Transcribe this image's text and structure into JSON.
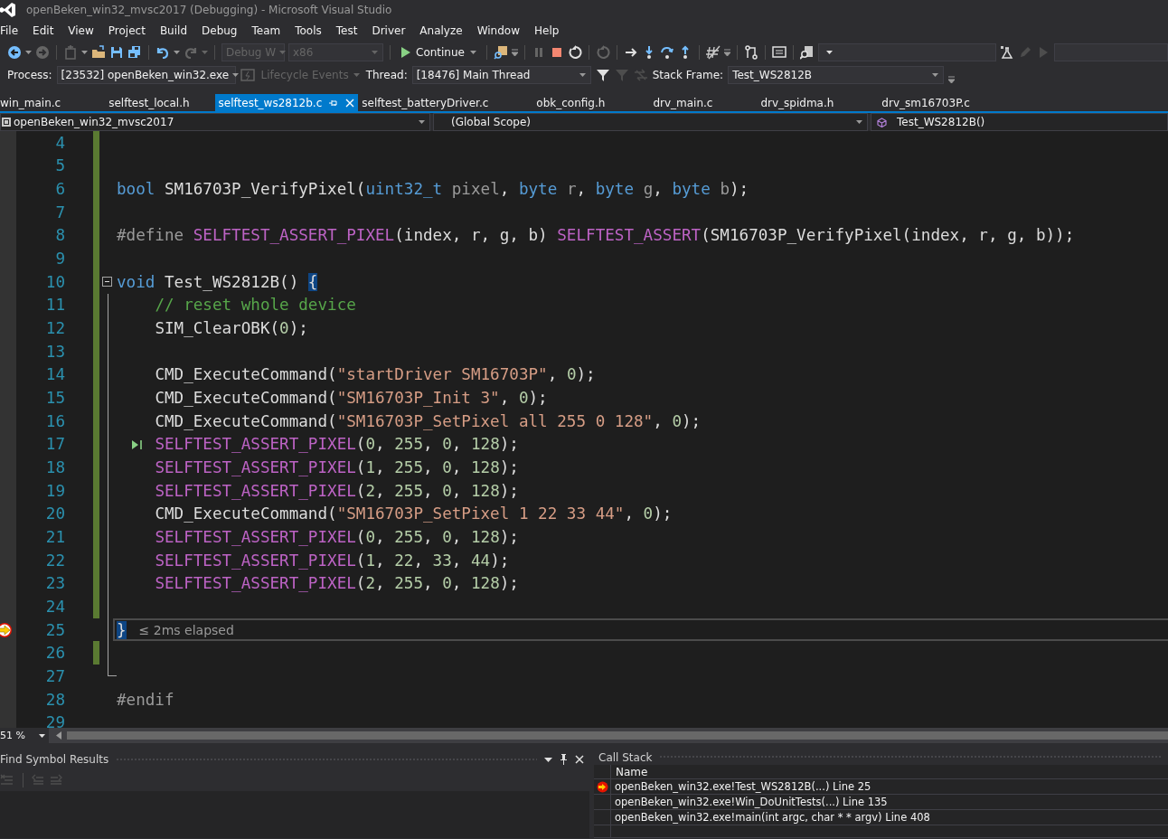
{
  "window": {
    "title": "openBeken_win32_mvsc2017 (Debugging) - Microsoft Visual Studio"
  },
  "menu": [
    "File",
    "Edit",
    "View",
    "Project",
    "Build",
    "Debug",
    "Team",
    "Tools",
    "Test",
    "Driver",
    "Analyze",
    "Window",
    "Help"
  ],
  "toolbar": {
    "configuration": "Debug W",
    "platform": "x86",
    "continue": "Continue"
  },
  "debug_location": {
    "process_label": "Process:",
    "process": "[23532] openBeken_win32.exe",
    "lifecycle": "Lifecycle Events",
    "thread_label": "Thread:",
    "thread": "[18476] Main Thread",
    "stack_frame_label": "Stack Frame:",
    "stack_frame": "Test_WS2812B"
  },
  "tabs": [
    {
      "label": "win_main.c",
      "selected": false
    },
    {
      "label": "selftest_local.h",
      "selected": false
    },
    {
      "label": "selftest_ws2812b.c",
      "selected": true
    },
    {
      "label": "selftest_batteryDriver.c",
      "selected": false
    },
    {
      "label": "obk_config.h",
      "selected": false
    },
    {
      "label": "drv_main.c",
      "selected": false
    },
    {
      "label": "drv_spidma.h",
      "selected": false
    },
    {
      "label": "drv_sm16703P.c",
      "selected": false
    }
  ],
  "navigation": {
    "project": "openBeken_win32_mvsc2017",
    "scope": "(Global Scope)",
    "member": "Test_WS2812B()"
  },
  "editor": {
    "zoom": "51 %",
    "lines": [
      {
        "number": "4",
        "changed": true,
        "foldable": false,
        "in_block": false,
        "current": false,
        "run_to_click": false
      },
      {
        "number": "5",
        "changed": true,
        "foldable": false,
        "in_block": false,
        "current": false,
        "run_to_click": false
      },
      {
        "number": "6",
        "changed": true,
        "foldable": false,
        "in_block": false,
        "current": false,
        "run_to_click": false,
        "tokens": [
          {
            "kind": "keyword",
            "text": "bool"
          },
          {
            "kind": "plain",
            "text": " SM16703P_VerifyPixel("
          },
          {
            "kind": "keyword",
            "text": "uint32_t"
          },
          {
            "kind": "param",
            "text": " pixel"
          },
          {
            "kind": "plain",
            "text": ", "
          },
          {
            "kind": "keyword",
            "text": "byte"
          },
          {
            "kind": "param",
            "text": " r"
          },
          {
            "kind": "plain",
            "text": ", "
          },
          {
            "kind": "keyword",
            "text": "byte"
          },
          {
            "kind": "param",
            "text": " g"
          },
          {
            "kind": "plain",
            "text": ", "
          },
          {
            "kind": "keyword",
            "text": "byte"
          },
          {
            "kind": "param",
            "text": " b"
          },
          {
            "kind": "plain",
            "text": ");"
          }
        ]
      },
      {
        "number": "7",
        "changed": true,
        "foldable": false,
        "in_block": false,
        "current": false,
        "run_to_click": false
      },
      {
        "number": "8",
        "changed": true,
        "foldable": false,
        "in_block": false,
        "current": false,
        "run_to_click": false,
        "tokens": [
          {
            "kind": "preprocessor",
            "text": "#define "
          },
          {
            "kind": "macro",
            "text": "SELFTEST_ASSERT_PIXEL"
          },
          {
            "kind": "plain",
            "text": "(index, r, g, b) "
          },
          {
            "kind": "macro",
            "text": "SELFTEST_ASSERT"
          },
          {
            "kind": "plain",
            "text": "(SM16703P_VerifyPixel(index, r, g, b));"
          }
        ]
      },
      {
        "number": "9",
        "changed": true,
        "foldable": false,
        "in_block": false,
        "current": false,
        "run_to_click": false
      },
      {
        "number": "10",
        "changed": true,
        "foldable": true,
        "in_block": false,
        "current": false,
        "run_to_click": false,
        "tokens": [
          {
            "kind": "keyword",
            "text": "void"
          },
          {
            "kind": "plain",
            "text": " Test_WS2812B() "
          },
          {
            "kind": "match",
            "text": "{"
          }
        ]
      },
      {
        "number": "11",
        "changed": true,
        "foldable": false,
        "in_block": true,
        "current": false,
        "run_to_click": false,
        "tokens": [
          {
            "kind": "comment",
            "text": "    // reset whole device"
          }
        ]
      },
      {
        "number": "12",
        "changed": true,
        "foldable": false,
        "in_block": true,
        "current": false,
        "run_to_click": false,
        "tokens": [
          {
            "kind": "plain",
            "text": "    SIM_ClearOBK("
          },
          {
            "kind": "number",
            "text": "0"
          },
          {
            "kind": "plain",
            "text": ");"
          }
        ]
      },
      {
        "number": "13",
        "changed": true,
        "foldable": false,
        "in_block": true,
        "current": false,
        "run_to_click": false
      },
      {
        "number": "14",
        "changed": true,
        "foldable": false,
        "in_block": true,
        "current": false,
        "run_to_click": false,
        "tokens": [
          {
            "kind": "plain",
            "text": "    CMD_ExecuteCommand("
          },
          {
            "kind": "string",
            "text": "\"startDriver SM16703P\""
          },
          {
            "kind": "plain",
            "text": ", "
          },
          {
            "kind": "number",
            "text": "0"
          },
          {
            "kind": "plain",
            "text": ");"
          }
        ]
      },
      {
        "number": "15",
        "changed": true,
        "foldable": false,
        "in_block": true,
        "current": false,
        "run_to_click": false,
        "tokens": [
          {
            "kind": "plain",
            "text": "    CMD_ExecuteCommand("
          },
          {
            "kind": "string",
            "text": "\"SM16703P_Init 3\""
          },
          {
            "kind": "plain",
            "text": ", "
          },
          {
            "kind": "number",
            "text": "0"
          },
          {
            "kind": "plain",
            "text": ");"
          }
        ]
      },
      {
        "number": "16",
        "changed": true,
        "foldable": false,
        "in_block": true,
        "current": false,
        "run_to_click": false,
        "tokens": [
          {
            "kind": "plain",
            "text": "    CMD_ExecuteCommand("
          },
          {
            "kind": "string",
            "text": "\"SM16703P_SetPixel all 255 0 128\""
          },
          {
            "kind": "plain",
            "text": ", "
          },
          {
            "kind": "number",
            "text": "0"
          },
          {
            "kind": "plain",
            "text": ");"
          }
        ]
      },
      {
        "number": "17",
        "changed": true,
        "foldable": false,
        "in_block": true,
        "current": false,
        "run_to_click": true,
        "tokens": [
          {
            "kind": "macro",
            "text": "    SELFTEST_ASSERT_PIXEL"
          },
          {
            "kind": "plain",
            "text": "("
          },
          {
            "kind": "number",
            "text": "0"
          },
          {
            "kind": "plain",
            "text": ", "
          },
          {
            "kind": "number",
            "text": "255"
          },
          {
            "kind": "plain",
            "text": ", "
          },
          {
            "kind": "number",
            "text": "0"
          },
          {
            "kind": "plain",
            "text": ", "
          },
          {
            "kind": "number",
            "text": "128"
          },
          {
            "kind": "plain",
            "text": ");"
          }
        ]
      },
      {
        "number": "18",
        "changed": true,
        "foldable": false,
        "in_block": true,
        "current": false,
        "run_to_click": false,
        "tokens": [
          {
            "kind": "macro",
            "text": "    SELFTEST_ASSERT_PIXEL"
          },
          {
            "kind": "plain",
            "text": "("
          },
          {
            "kind": "number",
            "text": "1"
          },
          {
            "kind": "plain",
            "text": ", "
          },
          {
            "kind": "number",
            "text": "255"
          },
          {
            "kind": "plain",
            "text": ", "
          },
          {
            "kind": "number",
            "text": "0"
          },
          {
            "kind": "plain",
            "text": ", "
          },
          {
            "kind": "number",
            "text": "128"
          },
          {
            "kind": "plain",
            "text": ");"
          }
        ]
      },
      {
        "number": "19",
        "changed": true,
        "foldable": false,
        "in_block": true,
        "current": false,
        "run_to_click": false,
        "tokens": [
          {
            "kind": "macro",
            "text": "    SELFTEST_ASSERT_PIXEL"
          },
          {
            "kind": "plain",
            "text": "("
          },
          {
            "kind": "number",
            "text": "2"
          },
          {
            "kind": "plain",
            "text": ", "
          },
          {
            "kind": "number",
            "text": "255"
          },
          {
            "kind": "plain",
            "text": ", "
          },
          {
            "kind": "number",
            "text": "0"
          },
          {
            "kind": "plain",
            "text": ", "
          },
          {
            "kind": "number",
            "text": "128"
          },
          {
            "kind": "plain",
            "text": ");"
          }
        ]
      },
      {
        "number": "20",
        "changed": true,
        "foldable": false,
        "in_block": true,
        "current": false,
        "run_to_click": false,
        "tokens": [
          {
            "kind": "plain",
            "text": "    CMD_ExecuteCommand("
          },
          {
            "kind": "string",
            "text": "\"SM16703P_SetPixel 1 22 33 44\""
          },
          {
            "kind": "plain",
            "text": ", "
          },
          {
            "kind": "number",
            "text": "0"
          },
          {
            "kind": "plain",
            "text": ");"
          }
        ]
      },
      {
        "number": "21",
        "changed": true,
        "foldable": false,
        "in_block": true,
        "current": false,
        "run_to_click": false,
        "tokens": [
          {
            "kind": "macro",
            "text": "    SELFTEST_ASSERT_PIXEL"
          },
          {
            "kind": "plain",
            "text": "("
          },
          {
            "kind": "number",
            "text": "0"
          },
          {
            "kind": "plain",
            "text": ", "
          },
          {
            "kind": "number",
            "text": "255"
          },
          {
            "kind": "plain",
            "text": ", "
          },
          {
            "kind": "number",
            "text": "0"
          },
          {
            "kind": "plain",
            "text": ", "
          },
          {
            "kind": "number",
            "text": "128"
          },
          {
            "kind": "plain",
            "text": ");"
          }
        ]
      },
      {
        "number": "22",
        "changed": true,
        "foldable": false,
        "in_block": true,
        "current": false,
        "run_to_click": false,
        "tokens": [
          {
            "kind": "macro",
            "text": "    SELFTEST_ASSERT_PIXEL"
          },
          {
            "kind": "plain",
            "text": "("
          },
          {
            "kind": "number",
            "text": "1"
          },
          {
            "kind": "plain",
            "text": ", "
          },
          {
            "kind": "number",
            "text": "22"
          },
          {
            "kind": "plain",
            "text": ", "
          },
          {
            "kind": "number",
            "text": "33"
          },
          {
            "kind": "plain",
            "text": ", "
          },
          {
            "kind": "number",
            "text": "44"
          },
          {
            "kind": "plain",
            "text": ");"
          }
        ]
      },
      {
        "number": "23",
        "changed": true,
        "foldable": false,
        "in_block": true,
        "current": false,
        "run_to_click": false,
        "tokens": [
          {
            "kind": "macro",
            "text": "    SELFTEST_ASSERT_PIXEL"
          },
          {
            "kind": "plain",
            "text": "("
          },
          {
            "kind": "number",
            "text": "2"
          },
          {
            "kind": "plain",
            "text": ", "
          },
          {
            "kind": "number",
            "text": "255"
          },
          {
            "kind": "plain",
            "text": ", "
          },
          {
            "kind": "number",
            "text": "0"
          },
          {
            "kind": "plain",
            "text": ", "
          },
          {
            "kind": "number",
            "text": "128"
          },
          {
            "kind": "plain",
            "text": ");"
          }
        ]
      },
      {
        "number": "24",
        "changed": true,
        "foldable": false,
        "in_block": true,
        "current": false,
        "run_to_click": false
      },
      {
        "number": "25",
        "changed": false,
        "foldable": false,
        "in_block": true,
        "current": true,
        "run_to_click": false,
        "hint": "≤ 2ms elapsed",
        "tokens": [
          {
            "kind": "match",
            "text": "}"
          }
        ]
      },
      {
        "number": "26",
        "changed": true,
        "foldable": false,
        "in_block": true,
        "current": false,
        "run_to_click": false
      },
      {
        "number": "27",
        "changed": false,
        "foldable": false,
        "in_block": true,
        "current": false,
        "run_to_click": false
      },
      {
        "number": "28",
        "changed": false,
        "foldable": false,
        "in_block": false,
        "current": false,
        "run_to_click": false,
        "tokens": [
          {
            "kind": "preprocessor",
            "text": "#endif"
          }
        ]
      },
      {
        "number": "29",
        "changed": false,
        "foldable": false,
        "in_block": false,
        "current": false,
        "run_to_click": false
      }
    ]
  },
  "find_symbol_results": {
    "title": "Find Symbol Results"
  },
  "call_stack": {
    "title": "Call Stack",
    "column": "Name",
    "rows": [
      {
        "text": "openBeken_win32.exe!Test_WS2812B(...) Line 25",
        "current": true
      },
      {
        "text": "openBeken_win32.exe!Win_DoUnitTests(...) Line 135",
        "current": false
      },
      {
        "text": "openBeken_win32.exe!main(int argc, char * * argv) Line 408",
        "current": false
      }
    ]
  }
}
